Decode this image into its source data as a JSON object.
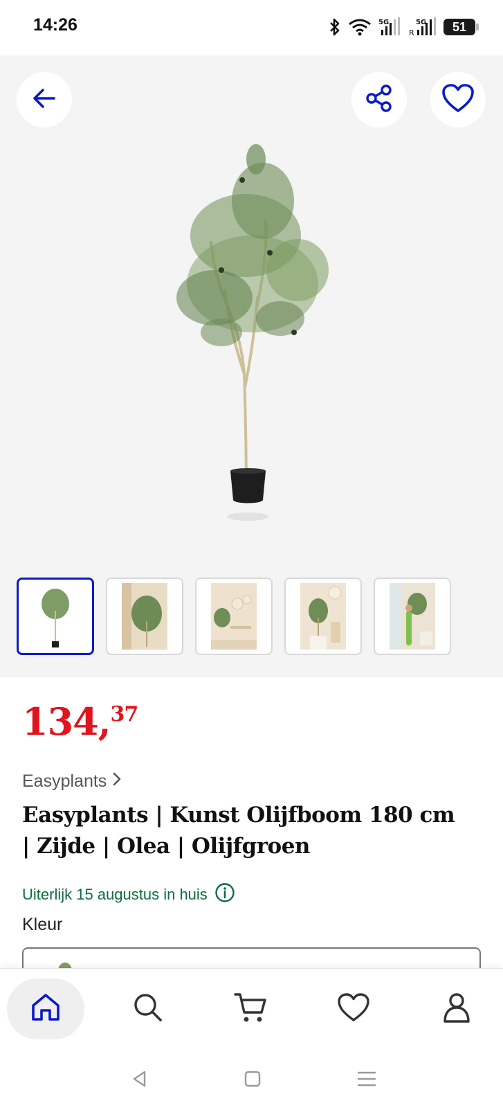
{
  "status_bar": {
    "time": "14:26",
    "battery": "51",
    "icons": [
      "bluetooth-icon",
      "wifi-icon",
      "signal-5g-icon",
      "signal-5g-roaming-icon",
      "battery-icon"
    ]
  },
  "gallery": {
    "icons": {
      "back": "arrow-left-icon",
      "share": "share-icon",
      "favorite": "heart-icon"
    },
    "main_image": "olive-tree-in-black-pot",
    "thumbnails": [
      {
        "image": "olive-tree-white-background",
        "selected": true
      },
      {
        "image": "olive-tree-by-curtains",
        "selected": false
      },
      {
        "image": "olive-tree-in-living-room",
        "selected": false
      },
      {
        "image": "olive-tree-with-lamp",
        "selected": false
      },
      {
        "image": "olive-tree-with-woman",
        "selected": false
      }
    ]
  },
  "product": {
    "price_whole": "134",
    "price_comma": ",",
    "price_cents": "37",
    "brand": "Easyplants",
    "title_line1": "Easyplants | Kunst Olijfboom 180 cm",
    "title_line2": "| Zijde | Olea | Olijfgroen",
    "delivery": "Uiterlijk 15 augustus in huis",
    "color_label": "Kleur"
  },
  "bottom_nav": {
    "items": [
      {
        "icon": "home-icon",
        "active": true
      },
      {
        "icon": "search-icon",
        "active": false
      },
      {
        "icon": "cart-icon",
        "active": false
      },
      {
        "icon": "heart-icon",
        "active": false
      },
      {
        "icon": "user-icon",
        "active": false
      }
    ]
  },
  "colors": {
    "accent": "#0a1ac8",
    "price": "#e0141e",
    "delivery": "#0b6e3b",
    "gallery_bg": "#f4f4f4"
  }
}
